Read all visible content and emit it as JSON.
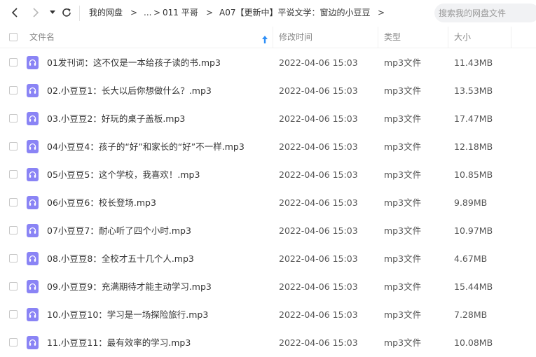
{
  "breadcrumb": {
    "root": "我的网盘",
    "ellipsis": "...",
    "level1": "011 平哥",
    "level2": "A07【更新中】平说文学：窗边的小豆豆",
    "separator": ">"
  },
  "search": {
    "placeholder": "搜索我的网盘文件"
  },
  "columns": {
    "name": "文件名",
    "modified": "修改时间",
    "type": "类型",
    "size": "大小"
  },
  "files": [
    {
      "name": "01发刊词：这不仅是一本给孩子读的书.mp3",
      "modified": "2022-04-06 15:03",
      "type": "mp3文件",
      "size": "11.43MB"
    },
    {
      "name": "02.小豆豆1：长大以后你想做什么？.mp3",
      "modified": "2022-04-06 15:03",
      "type": "mp3文件",
      "size": "13.53MB"
    },
    {
      "name": "03.小豆豆2：好玩的桌子盖板.mp3",
      "modified": "2022-04-06 15:03",
      "type": "mp3文件",
      "size": "17.47MB"
    },
    {
      "name": "04小豆豆4：孩子的“好”和家长的“好”不一样.mp3",
      "modified": "2022-04-06 15:03",
      "type": "mp3文件",
      "size": "12.18MB"
    },
    {
      "name": "05小豆豆5：这个学校，我喜欢！.mp3",
      "modified": "2022-04-06 15:03",
      "type": "mp3文件",
      "size": "10.85MB"
    },
    {
      "name": "06小豆豆6：校长登场.mp3",
      "modified": "2022-04-06 15:03",
      "type": "mp3文件",
      "size": "9.89MB"
    },
    {
      "name": "07小豆豆7：耐心听了四个小时.mp3",
      "modified": "2022-04-06 15:03",
      "type": "mp3文件",
      "size": "10.97MB"
    },
    {
      "name": "08.小豆豆8：全校才五十几个人.mp3",
      "modified": "2022-04-06 15:03",
      "type": "mp3文件",
      "size": "4.67MB"
    },
    {
      "name": "09.小豆豆9：充满期待才能主动学习.mp3",
      "modified": "2022-04-06 15:03",
      "type": "mp3文件",
      "size": "15.44MB"
    },
    {
      "name": "10.小豆豆10：学习是一场探险旅行.mp3",
      "modified": "2022-04-06 15:03",
      "type": "mp3文件",
      "size": "7.28MB"
    },
    {
      "name": "11.小豆豆11：最有效率的学习.mp3",
      "modified": "2022-04-06 15:03",
      "type": "mp3文件",
      "size": "10.08MB"
    }
  ],
  "colors": {
    "file_icon": "#8a84f5",
    "sort_arrow": "#2e8ff7",
    "search_bg": "#f1f2f4"
  },
  "icons": {
    "back": "back-arrow-icon",
    "forward": "forward-arrow-icon",
    "dropdown": "dropdown-icon",
    "refresh": "refresh-icon",
    "file": "audio-file-icon",
    "sort": "sort-ascending-icon"
  }
}
